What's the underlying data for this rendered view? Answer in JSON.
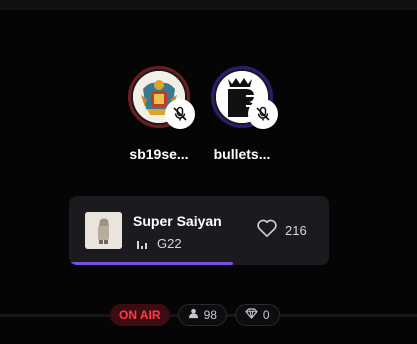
{
  "speakers": [
    {
      "name": "sb19se...",
      "ring_color": "#6d1d20",
      "muted": true,
      "icon": "mic-off-icon"
    },
    {
      "name": "bullets...",
      "ring_color": "#2a1f6e",
      "muted": true,
      "icon": "mic-off-icon"
    }
  ],
  "now_playing": {
    "title": "Super Saiyan",
    "subtitle": "G22",
    "likes": "216",
    "progress": 0.63,
    "accent": "#7a4fe0"
  },
  "status": {
    "on_air": "ON AIR",
    "listeners": "98",
    "gems": "0",
    "on_air_color": "#ff3b44"
  }
}
